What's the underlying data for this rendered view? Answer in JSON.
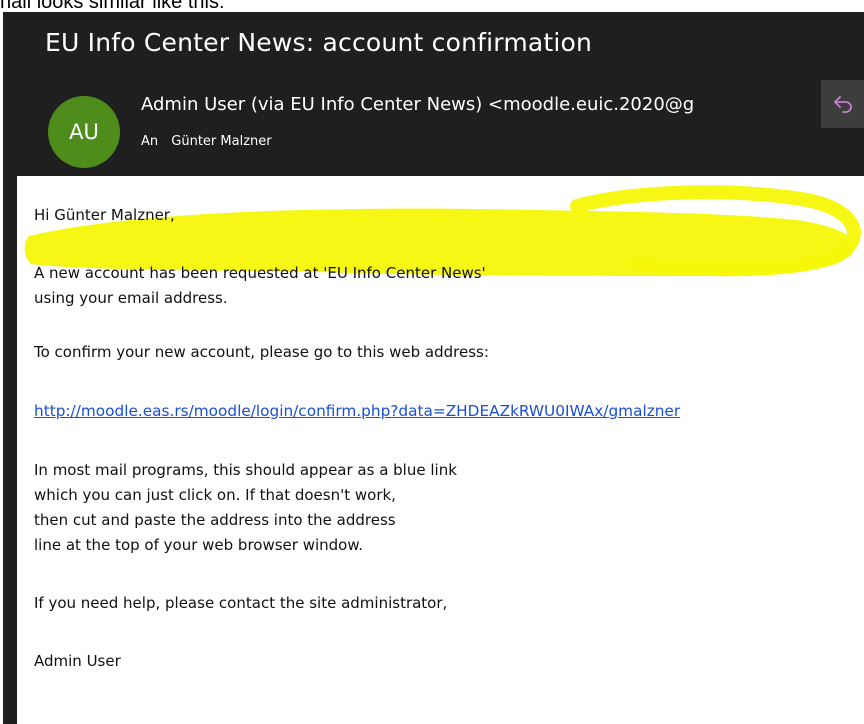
{
  "page_caption": "nail looks similar like this:",
  "email": {
    "subject": "EU Info Center News: account confirmation",
    "avatar_initials": "AU",
    "avatar_color": "#4e8c1c",
    "sender": "Admin User (via EU Info Center News) <moodle.euic.2020@g",
    "to_label": "An",
    "recipient": "Günter Malzner",
    "reply_icon": "reply-arrow-icon",
    "accent_color": "#c47fcf"
  },
  "body": {
    "greeting": "Hi Günter Malzner,",
    "para1_line1": "A new account has been requested at 'EU Info Center News'",
    "para1_line2": "using your email address.",
    "para2": "To confirm your new account, please go to this web address:",
    "link": "http://moodle.eas.rs/moodle/login/confirm.php?data=ZHDEAZkRWU0IWAx/gmalzner",
    "para3_line1": "In most mail programs, this should appear as a blue link",
    "para3_line2": "which you can just click on. If that doesn't work,",
    "para3_line3": "then cut and paste the address into the address",
    "para3_line4": "line at the top of your web browser window.",
    "para4": "If you need help, please contact the site administrator,",
    "signature": "Admin User",
    "highlight_color": "#f7f70a"
  }
}
